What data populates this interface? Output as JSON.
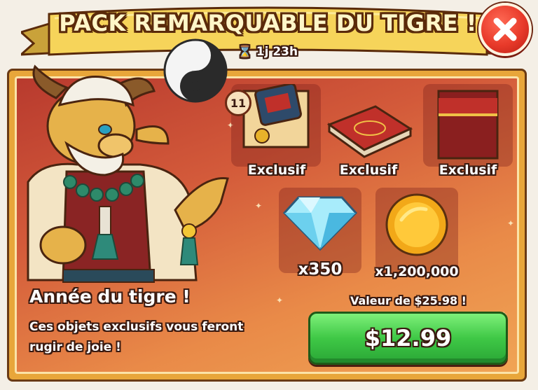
{
  "offer": {
    "title": "PACK REMARQUABLE DU TIGRE !",
    "timer": "1j 23h"
  },
  "items": [
    {
      "label": "Exclusif",
      "icon": "scroll-icon",
      "count": "11"
    },
    {
      "label": "Exclusif",
      "icon": "book-icon"
    },
    {
      "label": "Exclusif",
      "icon": "red-book-icon"
    }
  ],
  "currencies": [
    {
      "amount": "x350",
      "icon": "gem-icon"
    },
    {
      "amount": "x1,200,000",
      "icon": "gold-coin-icon"
    }
  ],
  "promo": {
    "title": "Année du tigre !",
    "description": "Ces objets exclusifs vous feront rugir de joie !"
  },
  "pricing": {
    "value_text": "Valeur de $25.98 !",
    "price": "$12.99"
  },
  "colors": {
    "banner": "#f6d45a",
    "close_button": "#e83a2a",
    "buy_button": "#3fc846",
    "panel_bg": "#d35a3a"
  }
}
